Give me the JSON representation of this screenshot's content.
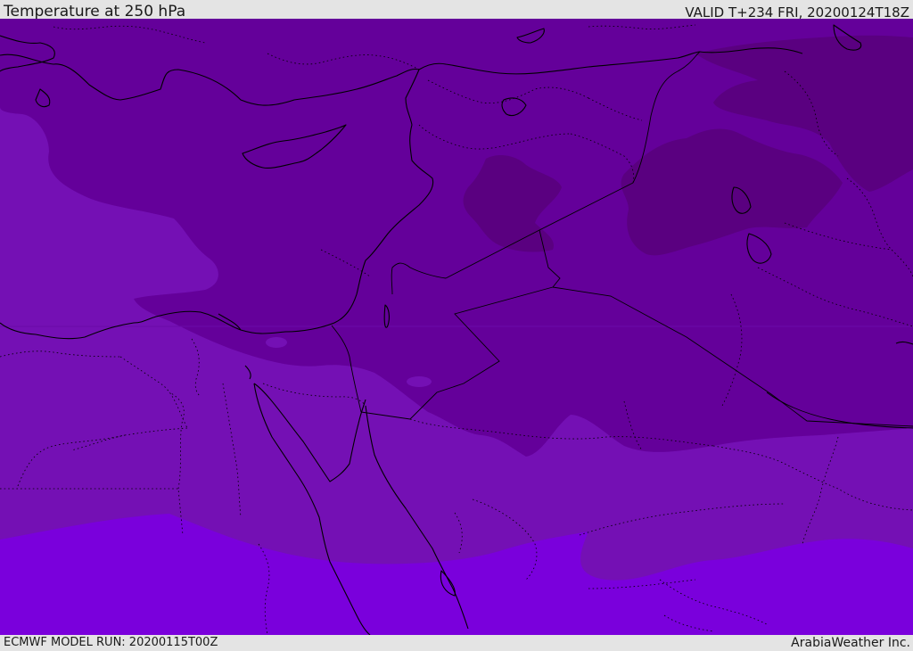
{
  "header": {
    "title": "Temperature at 250 hPa",
    "valid_time": "VALID T+234 FRI, 20200124T18Z"
  },
  "footer": {
    "model_run": "ECMWF MODEL RUN: 20200115T00Z",
    "credit": "ArabiaWeather Inc."
  },
  "map": {
    "colors": {
      "darkest": "#5a0080",
      "dark": "#64009a",
      "medium": "#7410b4",
      "bright": "#7a00dc",
      "coast": "#000000"
    }
  }
}
